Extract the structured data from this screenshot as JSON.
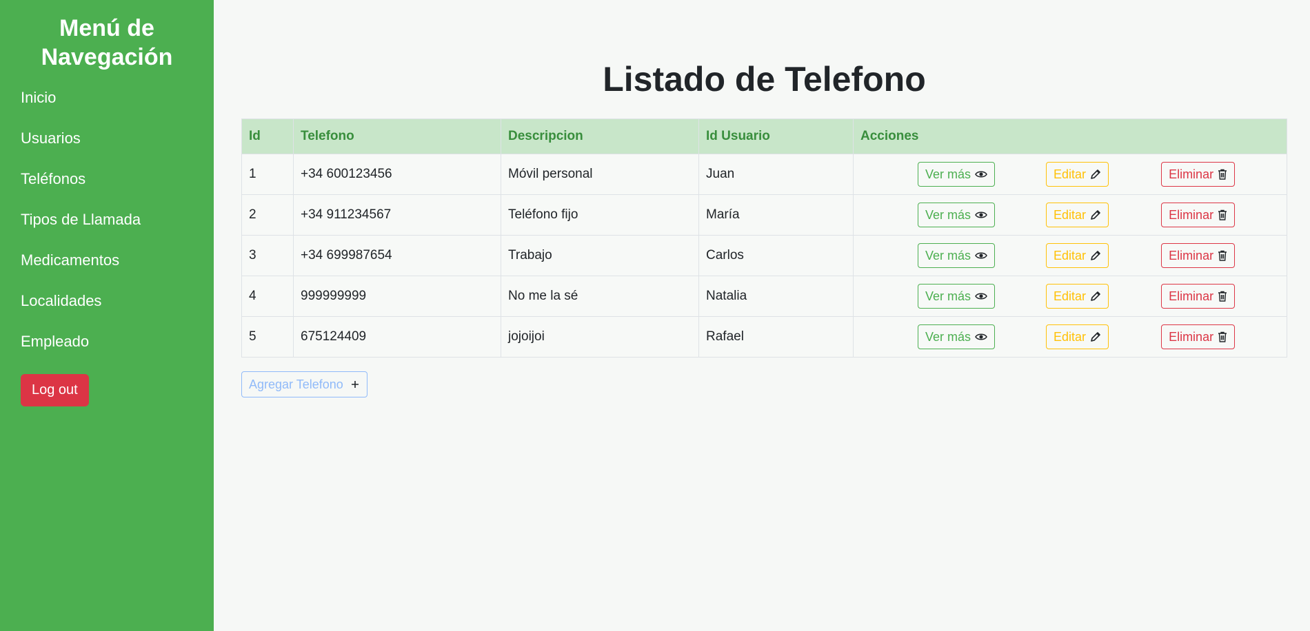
{
  "sidebar": {
    "title": "Menú de Navegación",
    "items": [
      {
        "label": "Inicio"
      },
      {
        "label": "Usuarios"
      },
      {
        "label": "Teléfonos"
      },
      {
        "label": "Tipos de Llamada"
      },
      {
        "label": "Medicamentos"
      },
      {
        "label": "Localidades"
      },
      {
        "label": "Empleado"
      }
    ],
    "logout_label": "Log out"
  },
  "main": {
    "title": "Listado de Telefono",
    "table": {
      "headers": [
        "Id",
        "Telefono",
        "Descripcion",
        "Id Usuario",
        "Acciones"
      ],
      "rows": [
        {
          "id": "1",
          "telefono": "+34 600123456",
          "descripcion": "Móvil personal",
          "usuario": "Juan"
        },
        {
          "id": "2",
          "telefono": "+34 911234567",
          "descripcion": "Teléfono fijo",
          "usuario": "María"
        },
        {
          "id": "3",
          "telefono": "+34 699987654",
          "descripcion": "Trabajo",
          "usuario": "Carlos"
        },
        {
          "id": "4",
          "telefono": "999999999",
          "descripcion": "No me la sé",
          "usuario": "Natalia"
        },
        {
          "id": "5",
          "telefono": "675124409",
          "descripcion": "jojoijoi",
          "usuario": "Rafael"
        }
      ],
      "actions": {
        "view_label": "Ver más",
        "edit_label": "Editar",
        "delete_label": "Eliminar"
      }
    },
    "add_button_label": "Agregar Telefono"
  },
  "colors": {
    "sidebar_bg": "#4caf50",
    "header_bg": "#c8e6c9",
    "header_text": "#388e3c",
    "view": "#4caf50",
    "edit": "#ffc107",
    "delete": "#dc3545",
    "add": "#90baf9"
  },
  "icons": {
    "view": "eye-icon",
    "edit": "pencil-icon",
    "delete": "trash-icon",
    "add": "plus-icon"
  }
}
